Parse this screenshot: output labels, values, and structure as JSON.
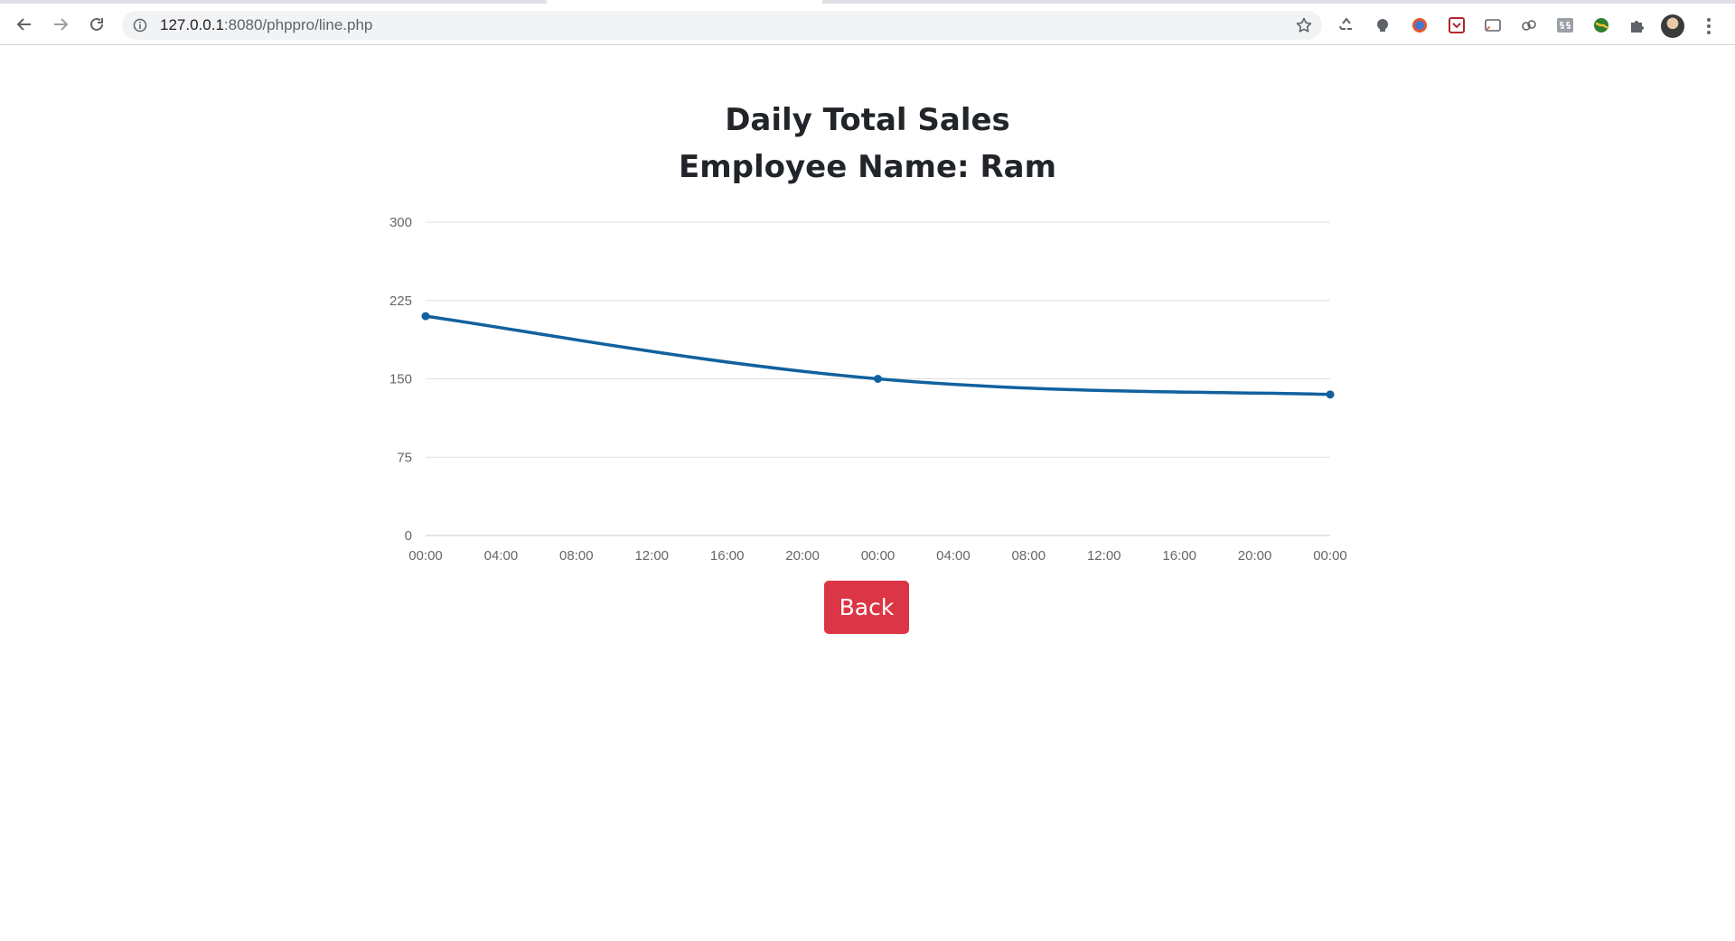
{
  "browser": {
    "url_host": "127.0.0.1",
    "url_rest": ":8080/phppro/line.php",
    "icons": [
      "back-arrow-icon",
      "forward-arrow-icon",
      "reload-icon",
      "site-info-icon",
      "bookmark-star-icon",
      "recycle-extension-icon",
      "alien-extension-icon",
      "globe-extension-icon",
      "pocket-extension-icon",
      "cast-extension-icon",
      "link-extension-icon",
      "ss-extension-icon",
      "earth-extension-icon",
      "puzzle-extensions-icon",
      "profile-avatar",
      "kebab-menu-icon"
    ]
  },
  "page": {
    "title": "Daily Total Sales",
    "subtitle": "Employee Name: Ram",
    "back_label": "Back",
    "back_color": "#dc3545"
  },
  "chart_data": {
    "type": "line",
    "line_color": "#11619e",
    "grid": true,
    "smooth": true,
    "ylim": [
      0,
      300
    ],
    "y_ticks": [
      "0",
      "75",
      "150",
      "225",
      "300"
    ],
    "x_ticks": [
      "00:00",
      "04:00",
      "08:00",
      "12:00",
      "16:00",
      "20:00",
      "00:00",
      "04:00",
      "08:00",
      "12:00",
      "16:00",
      "20:00",
      "00:00"
    ],
    "series": [
      {
        "x": [
          "day 1 00:00",
          "day 2 00:00",
          "day 3 00:00"
        ],
        "values": [
          210,
          150,
          135
        ]
      }
    ]
  }
}
